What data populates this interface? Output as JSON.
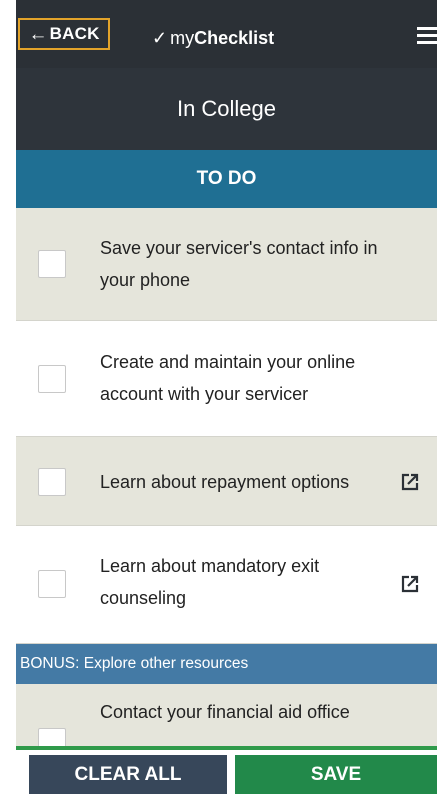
{
  "header": {
    "back_label": "BACK",
    "brand_prefix": "my",
    "brand_suffix": "Checklist",
    "menu_icon": "hamburger-menu-icon"
  },
  "section_title": "In College",
  "todo_label": "TO DO",
  "items": [
    {
      "text": "Save your servicer's contact info in your phone",
      "checked": false,
      "external_link": false
    },
    {
      "text": "Create and maintain your online account with your servicer",
      "checked": false,
      "external_link": false
    },
    {
      "text": "Learn about repayment options",
      "checked": false,
      "external_link": true
    },
    {
      "text": "Learn about mandatory exit counseling",
      "checked": false,
      "external_link": true
    }
  ],
  "bonus": {
    "label": "BONUS: Explore other resources",
    "items": [
      {
        "text": "Contact your financial aid office",
        "checked": false
      }
    ]
  },
  "footer": {
    "clear_label": "CLEAR ALL",
    "save_label": "SAVE"
  },
  "colors": {
    "header_bg": "#2b3036",
    "todo_bar": "#1f6f93",
    "bonus_bar": "#447aa5",
    "shaded_row": "#e5e5db",
    "accent_border": "#e2a32a",
    "save_button": "#22894a",
    "clear_button": "#37475a"
  }
}
